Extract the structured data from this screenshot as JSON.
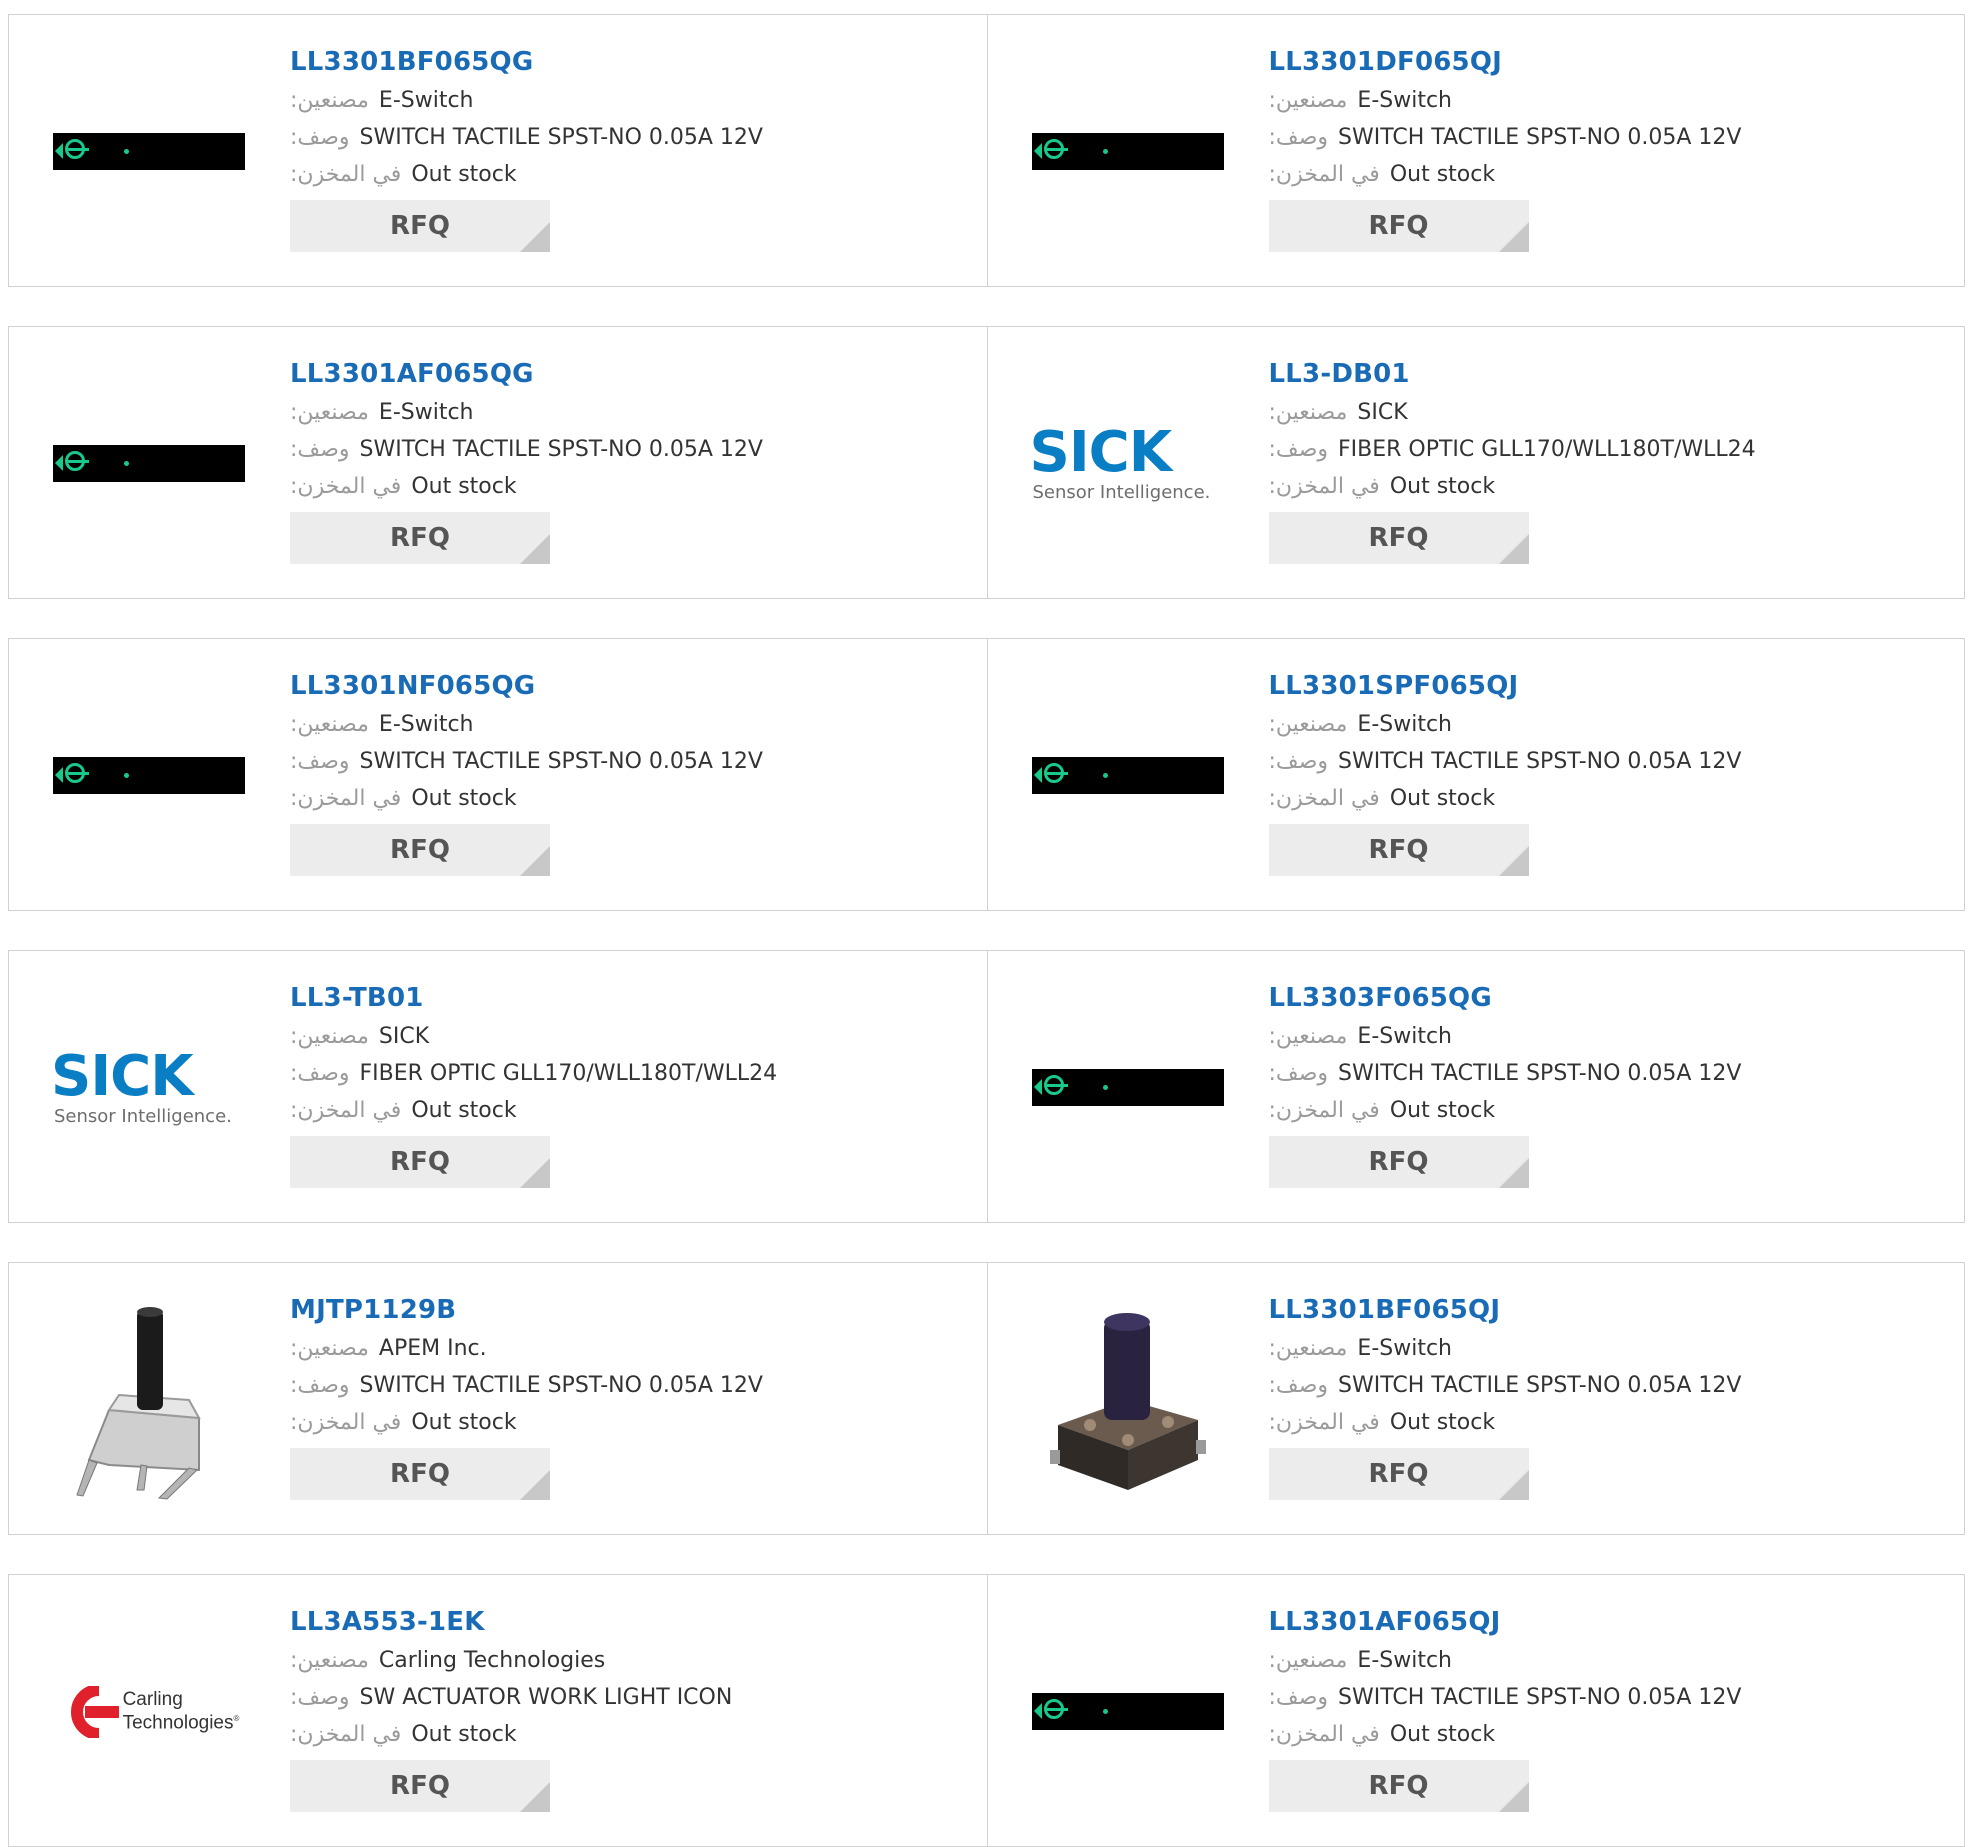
{
  "labels": {
    "manufacturer": ":مصنعين",
    "description": ":وصف",
    "stock": ":في المخزن",
    "rfq": "RFQ"
  },
  "products": [
    {
      "part": "LL3301BF065QG",
      "manufacturer": "E-Switch",
      "description": "SWITCH TACTILE SPST-NO 0.05A 12V",
      "stock": "Out stock",
      "image": "eswitch-placeholder"
    },
    {
      "part": "LL3301DF065QJ",
      "manufacturer": "E-Switch",
      "description": "SWITCH TACTILE SPST-NO 0.05A 12V",
      "stock": "Out stock",
      "image": "eswitch-placeholder"
    },
    {
      "part": "LL3301AF065QG",
      "manufacturer": "E-Switch",
      "description": "SWITCH TACTILE SPST-NO 0.05A 12V",
      "stock": "Out stock",
      "image": "eswitch-placeholder"
    },
    {
      "part": "LL3-DB01",
      "manufacturer": "SICK",
      "description": "FIBER OPTIC GLL170/WLL180T/WLL24",
      "stock": "Out stock",
      "image": "sick-logo"
    },
    {
      "part": "LL3301NF065QG",
      "manufacturer": "E-Switch",
      "description": "SWITCH TACTILE SPST-NO 0.05A 12V",
      "stock": "Out stock",
      "image": "eswitch-placeholder"
    },
    {
      "part": "LL3301SPF065QJ",
      "manufacturer": "E-Switch",
      "description": "SWITCH TACTILE SPST-NO 0.05A 12V",
      "stock": "Out stock",
      "image": "eswitch-placeholder"
    },
    {
      "part": "LL3-TB01",
      "manufacturer": "SICK",
      "description": "FIBER OPTIC GLL170/WLL180T/WLL24",
      "stock": "Out stock",
      "image": "sick-logo"
    },
    {
      "part": "LL3303F065QG",
      "manufacturer": "E-Switch",
      "description": "SWITCH TACTILE SPST-NO 0.05A 12V",
      "stock": "Out stock",
      "image": "eswitch-placeholder"
    },
    {
      "part": "MJTP1129B",
      "manufacturer": "APEM Inc.",
      "description": "SWITCH TACTILE SPST-NO 0.05A 12V",
      "stock": "Out stock",
      "image": "tactile-switch-tall-photo"
    },
    {
      "part": "LL3301BF065QJ",
      "manufacturer": "E-Switch",
      "description": "SWITCH TACTILE SPST-NO 0.05A 12V",
      "stock": "Out stock",
      "image": "tactile-switch-square-photo"
    },
    {
      "part": "LL3A553-1EK",
      "manufacturer": "Carling Technologies",
      "description": "SW ACTUATOR WORK LIGHT ICON",
      "stock": "Out stock",
      "image": "carling-logo"
    },
    {
      "part": "LL3301AF065QJ",
      "manufacturer": "E-Switch",
      "description": "SWITCH TACTILE SPST-NO 0.05A 12V",
      "stock": "Out stock",
      "image": "eswitch-placeholder"
    }
  ],
  "logos": {
    "sick": {
      "word": "SICK",
      "tagline": "Sensor Intelligence."
    },
    "carling": {
      "line1": "Carling",
      "line2": "Technologies"
    }
  },
  "colors": {
    "part_link": "#1a6bb6",
    "label_gray": "#9a9a9a",
    "border": "#d2d2d2",
    "rfq_bg": "#ececec",
    "sick_blue": "#0a7ec5",
    "carling_red": "#e0202a",
    "eswitch_green": "#19c98b"
  }
}
